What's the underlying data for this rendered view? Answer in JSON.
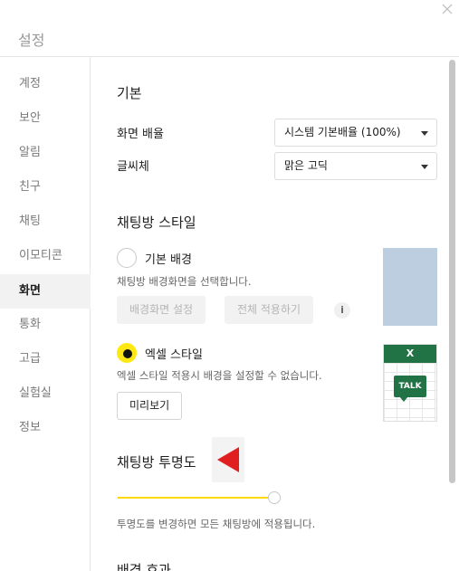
{
  "window": {
    "title": "설정"
  },
  "sidebar": {
    "items": [
      {
        "label": "계정",
        "active": false
      },
      {
        "label": "보안",
        "active": false
      },
      {
        "label": "알림",
        "active": false
      },
      {
        "label": "친구",
        "active": false
      },
      {
        "label": "채팅",
        "active": false
      },
      {
        "label": "이모티콘",
        "active": false
      },
      {
        "label": "화면",
        "active": true
      },
      {
        "label": "통화",
        "active": false
      },
      {
        "label": "고급",
        "active": false
      },
      {
        "label": "실험실",
        "active": false
      },
      {
        "label": "정보",
        "active": false
      }
    ]
  },
  "basic": {
    "heading": "기본",
    "zoom_label": "화면 배율",
    "zoom_value": "시스템 기본배율 (100%)",
    "font_label": "글씨체",
    "font_value": "맑은 고딕"
  },
  "chat_style": {
    "heading": "채팅방 스타일",
    "default_bg": {
      "label": "기본 배경",
      "desc": "채팅방 배경화면을 선택합니다.",
      "set_bg_button": "배경화면 설정",
      "apply_all_button": "전체 적용하기",
      "info_glyph": "i",
      "selected": false
    },
    "excel": {
      "label": "엑셀 스타일",
      "desc": "엑셀 스타일 적용시 배경을 설정할 수 없습니다.",
      "preview_button": "미리보기",
      "selected": true,
      "thumb_header": "X",
      "thumb_badge": "TALK"
    }
  },
  "transparency": {
    "heading": "채팅방 투명도",
    "desc": "투명도를 변경하면 모든 채팅방에 적용됩니다.",
    "level": 0.0
  },
  "background_effect": {
    "heading": "배경 효과"
  },
  "colors": {
    "accent": "#ffe812",
    "slider": "#ffd800",
    "excel_green": "#217346",
    "thumb_blue": "#bccee0",
    "arrow_red": "#e02020"
  },
  "icons": {
    "close": "close-icon",
    "info": "info-icon",
    "arrow": "red-arrow-pointer-icon",
    "dropdown": "chevron-down-icon"
  }
}
